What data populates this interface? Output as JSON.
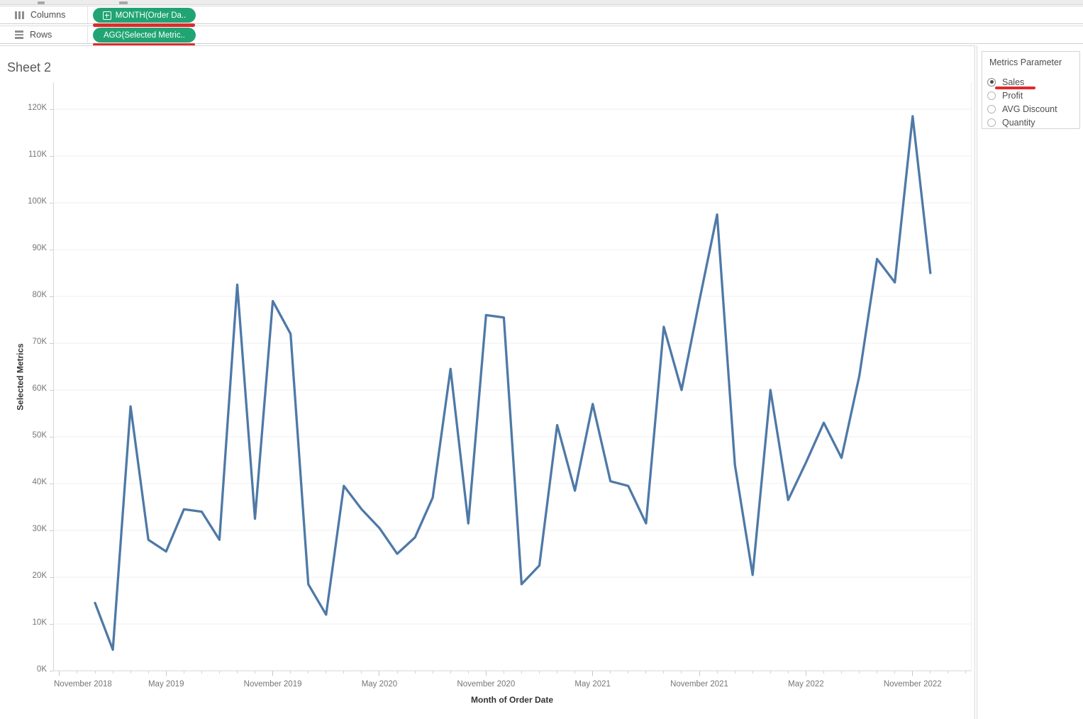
{
  "shelves": {
    "columns_label": "Columns",
    "rows_label": "Rows",
    "columns_pill": "MONTH(Order Da..",
    "rows_pill": "AGG(Selected Metric.."
  },
  "sheet": {
    "title": "Sheet 2"
  },
  "parameter_panel": {
    "title": "Metrics Parameter",
    "options": [
      {
        "label": "Sales",
        "selected": true,
        "underlined": true
      },
      {
        "label": "Profit",
        "selected": false
      },
      {
        "label": "AVG Discount",
        "selected": false
      },
      {
        "label": "Quantity",
        "selected": false
      }
    ]
  },
  "colors": {
    "pill_green": "#21a473",
    "annotation_red": "#e02a2d",
    "line_blue": "#4e79a7",
    "gridline": "#efefef",
    "axis_line": "#d6d6d6",
    "tick_text": "#767676"
  },
  "annotations": {
    "underlined_items": [
      "MONTH(Order Da..",
      "AGG(Selected Metric..",
      "Sales"
    ],
    "underline_color": "#e02a2d"
  },
  "chart_data": {
    "type": "line",
    "title": "Sheet 2",
    "xlabel": "Month of Order Date",
    "ylabel": "Selected Metrics",
    "series_name": "AGG(Selected Metrics) — Sales",
    "unit": "thousands (K)",
    "ylim_k": [
      0,
      126
    ],
    "grid": "horizontal only",
    "legend": "none",
    "y_ticks_k": [
      0,
      10,
      20,
      30,
      40,
      50,
      60,
      70,
      80,
      90,
      100,
      110,
      120
    ],
    "x_tick_labels": [
      "November 2018",
      "May 2019",
      "November 2019",
      "May 2020",
      "November 2020",
      "May 2021",
      "November 2021",
      "May 2022",
      "November 2022"
    ],
    "x": [
      "Jan 2019",
      "Feb 2019",
      "Mar 2019",
      "Apr 2019",
      "May 2019",
      "Jun 2019",
      "Jul 2019",
      "Aug 2019",
      "Sep 2019",
      "Oct 2019",
      "Nov 2019",
      "Dec 2019",
      "Jan 2020",
      "Feb 2020",
      "Mar 2020",
      "Apr 2020",
      "May 2020",
      "Jun 2020",
      "Jul 2020",
      "Aug 2020",
      "Sep 2020",
      "Oct 2020",
      "Nov 2020",
      "Dec 2020",
      "Jan 2021",
      "Feb 2021",
      "Mar 2021",
      "Apr 2021",
      "May 2021",
      "Jun 2021",
      "Jul 2021",
      "Aug 2021",
      "Sep 2021",
      "Oct 2021",
      "Nov 2021",
      "Dec 2021",
      "Jan 2022",
      "Feb 2022",
      "Mar 2022",
      "Apr 2022",
      "May 2022",
      "Jun 2022",
      "Jul 2022",
      "Aug 2022",
      "Sep 2022",
      "Oct 2022",
      "Nov 2022",
      "Dec 2022"
    ],
    "values_k": [
      14.5,
      4.5,
      56.5,
      28,
      25.5,
      34.5,
      34,
      28,
      82.5,
      32.5,
      79,
      72,
      18.5,
      12,
      39.5,
      34.5,
      30.5,
      25,
      28.5,
      37,
      64.5,
      31.5,
      76,
      75.5,
      18.5,
      22.5,
      52.5,
      38.5,
      57,
      40.5,
      39.5,
      31.5,
      73.5,
      60,
      79,
      97.5,
      44,
      20.5,
      60,
      36.5,
      44.5,
      53,
      45.5,
      63,
      88,
      83,
      118.5,
      85
    ]
  }
}
